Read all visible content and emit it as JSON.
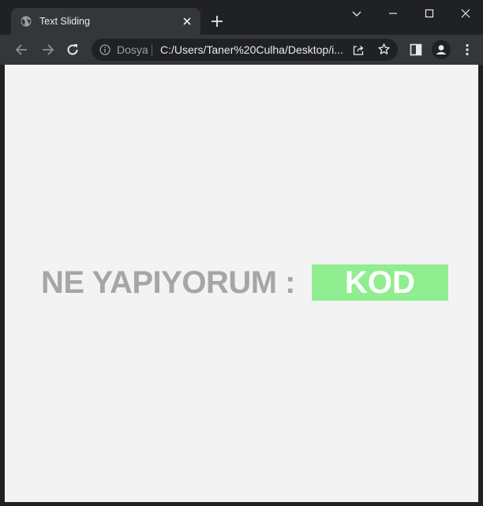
{
  "browser": {
    "tab": {
      "title": "Text Sliding"
    },
    "omnibox": {
      "scheme_label": "Dosya",
      "url": "C:/Users/Taner%20Culha/Desktop/i..."
    },
    "colors": {
      "frame": "#202124",
      "toolbar": "#35363a",
      "icon": "#e8eaed"
    }
  },
  "page": {
    "static_text": "NE YAPIYORUM :",
    "sliding_word": "KOD",
    "colors": {
      "background": "#f3f3f3",
      "text": "#a6a6a6",
      "word_bg": "#90ee90",
      "word_text": "#ffffff"
    }
  },
  "icons": {
    "tab_favicon": "globe-icon",
    "tab_close": "close-icon",
    "new_tab": "plus-icon",
    "tab_search": "chevron-down-icon",
    "minimize": "minimize-icon",
    "maximize": "maximize-icon",
    "close_window": "close-icon",
    "back": "arrow-left-icon",
    "forward": "arrow-right-icon",
    "reload": "reload-icon",
    "site_info": "info-icon",
    "share": "share-icon",
    "bookmark": "star-icon",
    "side_panel": "side-panel-icon",
    "profile": "person-icon",
    "menu": "kebab-menu-icon"
  }
}
